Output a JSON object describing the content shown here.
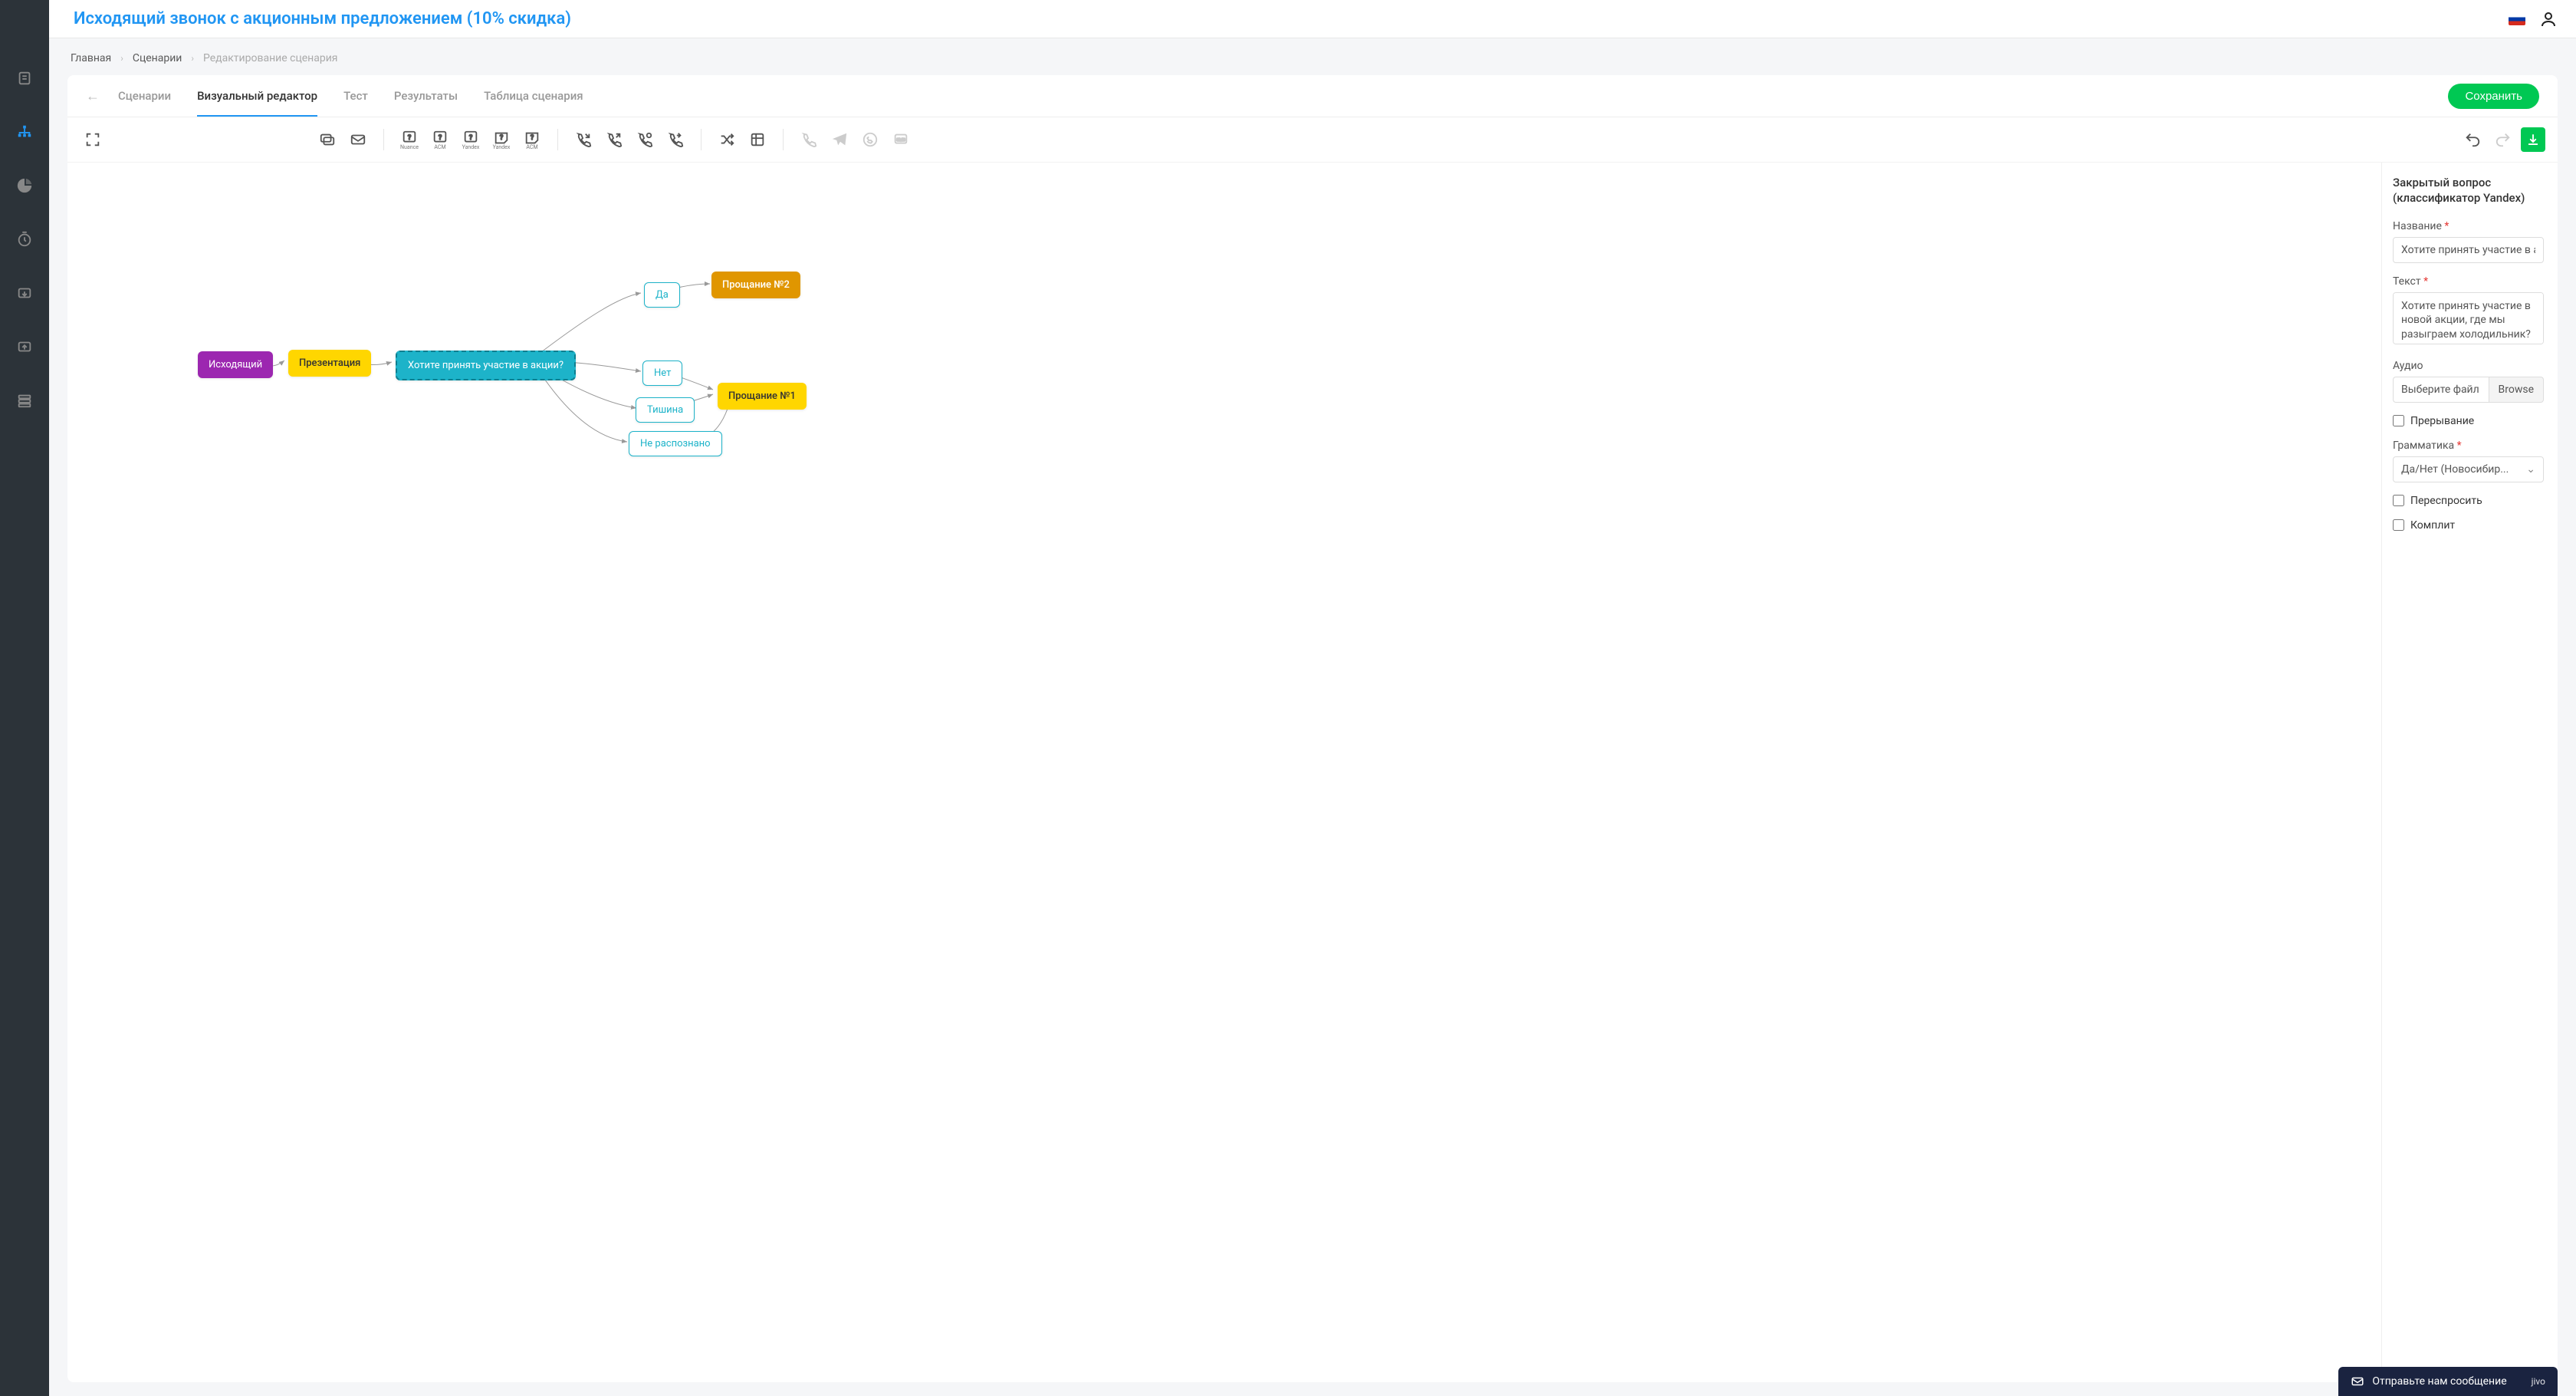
{
  "header": {
    "title": "Исходящий звонок с акционным предложением (10% скидка)"
  },
  "breadcrumb": {
    "items": [
      "Главная",
      "Сценарии"
    ],
    "current": "Редактирование сценария"
  },
  "tabs": {
    "items": [
      "Сценарии",
      "Визуальный редактор",
      "Тест",
      "Результаты",
      "Таблица сценария"
    ],
    "active_index": 1,
    "save_label": "Сохранить"
  },
  "toolbar": {
    "question_labels": [
      "Nuance",
      "ACM",
      "Yandex",
      "Yandex",
      "ACM"
    ]
  },
  "nodes": {
    "outgoing": "Исходящий",
    "presentation": "Презентация",
    "question": "Хотите принять участие в акции?",
    "yes": "Да",
    "no": "Нет",
    "silence": "Тишина",
    "unrecognized": "Не распознано",
    "farewell1": "Прощание №1",
    "farewell2": "Прощание №2"
  },
  "props": {
    "title": "Закрытый вопрос (классификатор Yandex)",
    "name_label": "Название",
    "name_value": "Хотите принять участие в а",
    "text_label": "Текст",
    "text_value": "Хотите принять участие в новой акции, где мы разыграем холодильник?",
    "audio_label": "Аудио",
    "audio_file_placeholder": "Выберите файл",
    "browse_label": "Browse",
    "interrupt_label": "Прерывание",
    "grammar_label": "Грамматика",
    "grammar_value": "Да/Нет (Новосибир...",
    "reask_label": "Переспросить",
    "complete_label": "Комплит"
  },
  "chat": {
    "text": "Отправьте нам сообщение",
    "brand": "jivo"
  }
}
